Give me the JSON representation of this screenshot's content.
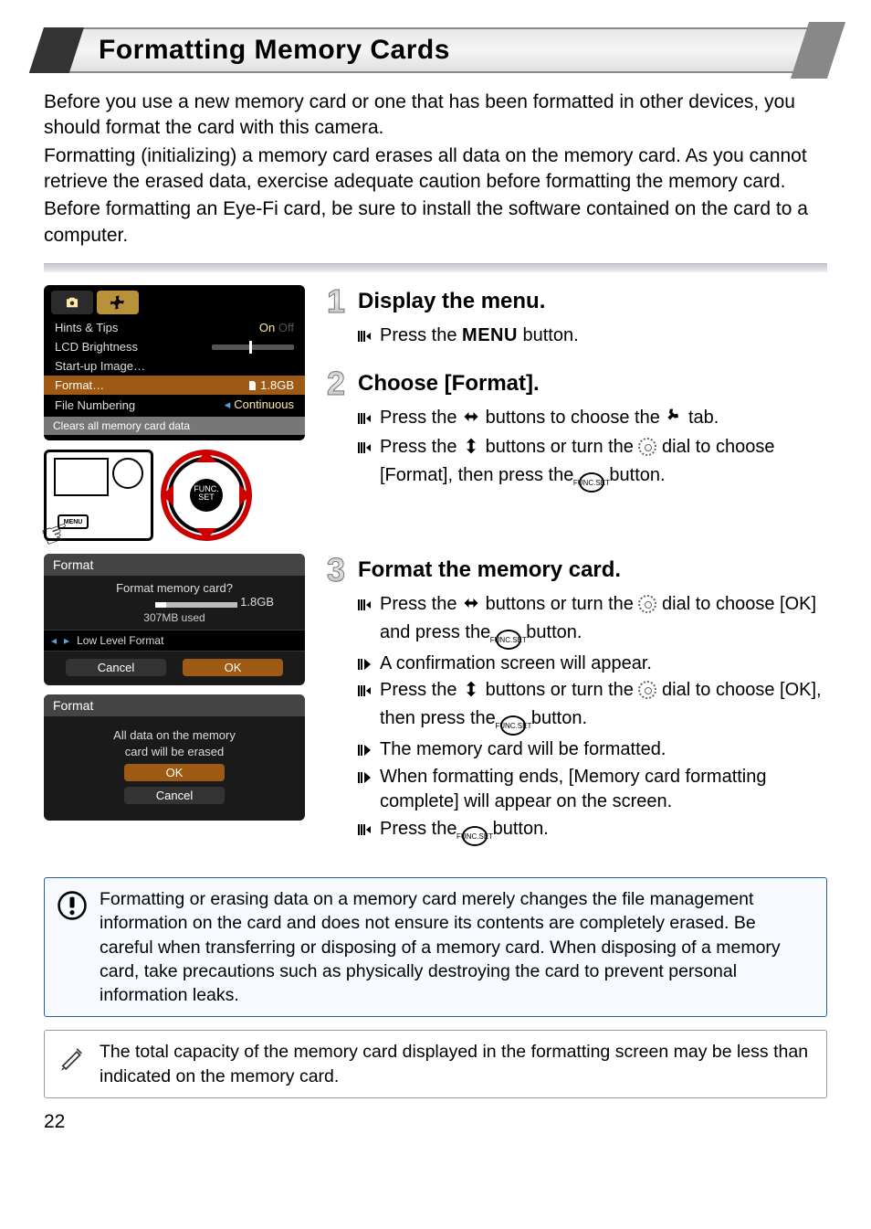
{
  "title": "Formatting Memory Cards",
  "intro": {
    "p1": "Before you use a new memory card or one that has been formatted in other devices, you should format the card with this camera.",
    "p2": "Formatting (initializing) a memory card erases all data on the memory card. As you cannot retrieve the erased data, exercise adequate caution before formatting the memory card.",
    "p3": "Before formatting an Eye-Fi card, be sure to install the software contained on the card to a computer."
  },
  "menu": {
    "rows": {
      "hints": {
        "label": "Hints & Tips",
        "value_on": "On",
        "value_off": "Off"
      },
      "lcd": {
        "label": "LCD Brightness"
      },
      "start": {
        "label": "Start-up Image…"
      },
      "format": {
        "label": "Format…",
        "value": "1.8GB"
      },
      "num": {
        "label": "File Numbering",
        "value": "Continuous"
      }
    },
    "footer": "Clears all memory card data"
  },
  "dial_center_top": "FUNC.",
  "dial_center_bot": "SET",
  "camback_menu": "MENU",
  "steps": {
    "s1": {
      "title": "Display the menu.",
      "b1_a": "Press the ",
      "b1_menu": "MENU",
      "b1_b": " button."
    },
    "s2": {
      "title": "Choose [Format].",
      "b1_a": "Press the ",
      "b1_b": " buttons to choose the ",
      "b1_c": " tab.",
      "b2_a": "Press the ",
      "b2_b": " buttons or turn the ",
      "b2_c": " dial to choose [Format], then press the ",
      "b2_d": " button."
    },
    "s3": {
      "title": "Format the memory card.",
      "b1_a": "Press the ",
      "b1_b": " buttons or turn the ",
      "b1_c": " dial to choose [OK] and press the ",
      "b1_d": " button.",
      "b2": "A confirmation screen will appear.",
      "b3_a": "Press the ",
      "b3_b": " buttons or turn the ",
      "b3_c": " dial to choose [OK], then press the ",
      "b3_d": " button.",
      "b4": "The memory card will be formatted.",
      "b5": "When formatting ends, [Memory card formatting complete] will appear on the screen.",
      "b6_a": "Press the ",
      "b6_b": " button."
    }
  },
  "dlg_format": {
    "title": "Format",
    "question": "Format memory card?",
    "size": "1.8GB",
    "used": "307MB used",
    "lowlevel": "Low Level Format",
    "cancel": "Cancel",
    "ok": "OK"
  },
  "dlg_confirm": {
    "title": "Format",
    "l1": "All data on the memory",
    "l2": "card will be erased",
    "ok": "OK",
    "cancel": "Cancel"
  },
  "notes": {
    "warn": "Formatting or erasing data on a memory card merely changes the file management information on the card and does not ensure its contents are completely erased. Be careful when transferring or disposing of a memory card. When disposing of a memory card, take precautions such as physically destroying the card to prevent personal information leaks.",
    "info": "The total capacity of the memory card displayed in the formatting screen may be less than indicated on the memory card."
  },
  "page_number": "22",
  "func_label_top": "FUNC.",
  "func_label_bot": "SET"
}
